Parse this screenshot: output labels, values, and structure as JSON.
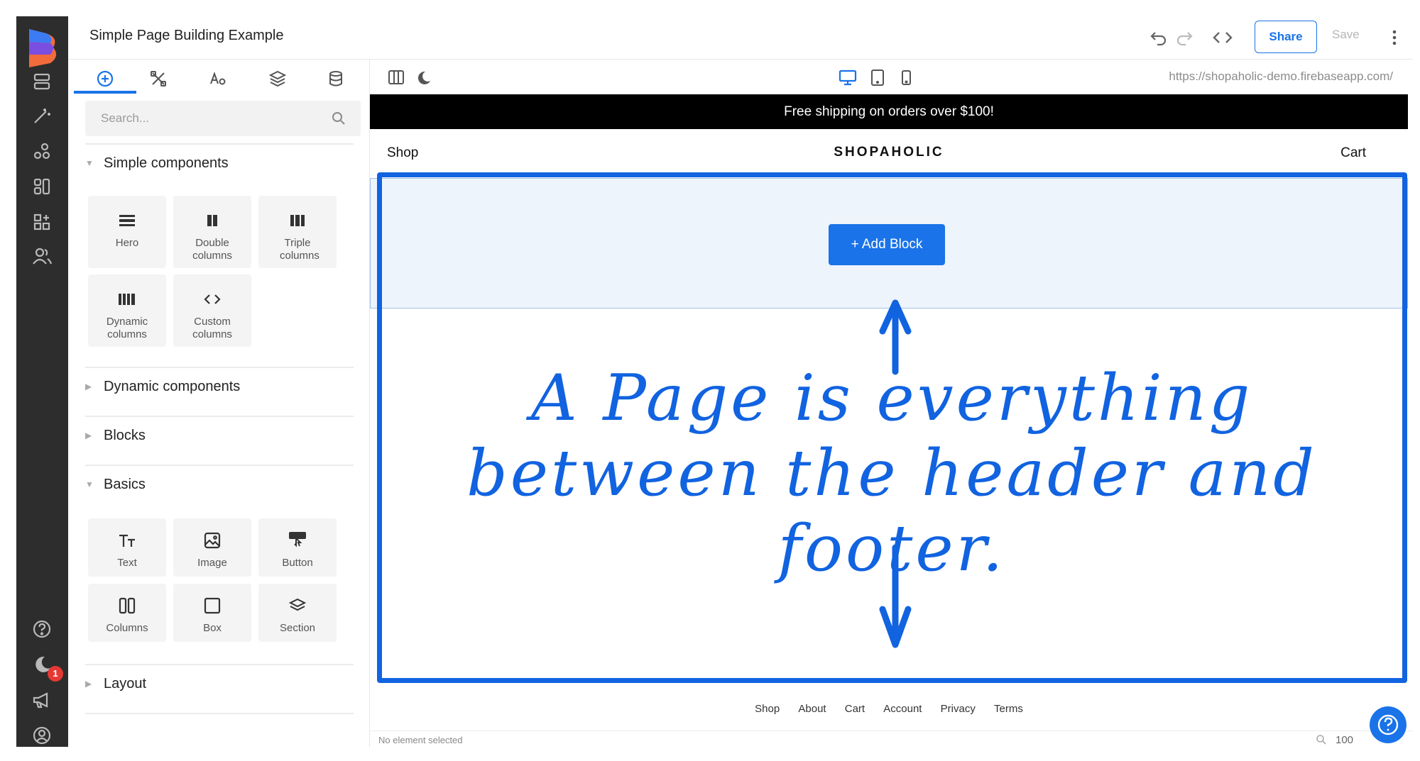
{
  "app": {
    "title": "Simple Page Building Example"
  },
  "toolbar": {
    "share_label": "Share",
    "save_label": "Save"
  },
  "rail": {
    "notification_count": "1",
    "icons": [
      "storage-icon",
      "magic-wand-icon",
      "integrations-icon",
      "data-icon",
      "apps-icon",
      "users-icon",
      "help-icon",
      "dark-mode-icon",
      "announcements-icon",
      "account-icon"
    ]
  },
  "panel": {
    "tabs": [
      "add-icon",
      "tools-icon",
      "typography-icon",
      "layers-icon",
      "database-icon"
    ],
    "search_placeholder": "Search...",
    "sections": {
      "simple": "Simple components",
      "dynamic": "Dynamic components",
      "blocks": "Blocks",
      "basics": "Basics",
      "layout": "Layout"
    },
    "simple_components": [
      {
        "label": "Hero"
      },
      {
        "label": "Double columns"
      },
      {
        "label": "Triple columns"
      },
      {
        "label": "Dynamic columns"
      },
      {
        "label": "Custom columns"
      }
    ],
    "basics": [
      {
        "label": "Text"
      },
      {
        "label": "Image"
      },
      {
        "label": "Button"
      },
      {
        "label": "Columns"
      },
      {
        "label": "Box"
      },
      {
        "label": "Section"
      }
    ]
  },
  "canvas": {
    "url": "https://shopaholic-demo.firebaseapp.com/",
    "announcement": "Free shipping on orders over $100!",
    "nav": {
      "shop": "Shop",
      "brand": "SHOPAHOLIC",
      "cart": "Cart"
    },
    "add_block_label": "+ Add Block",
    "annotation_line1": "A Page is everything",
    "annotation_line2": "between the header and footer.",
    "footer_links": [
      "Shop",
      "About",
      "Cart",
      "Account",
      "Privacy",
      "Terms"
    ],
    "status": "No element selected",
    "zoom": "100"
  },
  "colors": {
    "accent": "#1a73e8",
    "annotation": "#1163e0",
    "rail": "#2d2d2d"
  }
}
